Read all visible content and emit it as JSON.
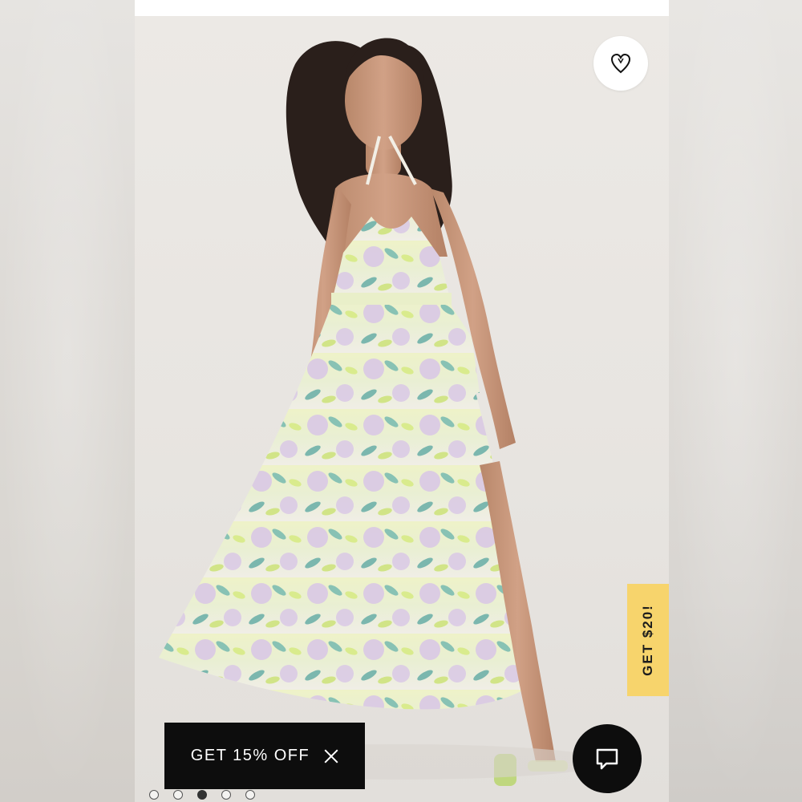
{
  "product": {
    "image_alt": "Model wearing floral halter maxi dress",
    "favorited": false
  },
  "icons": {
    "favorite": "heart-outline-icon",
    "close": "close-icon",
    "chat": "chat-bubble-icon"
  },
  "promo_tab": {
    "label": "GET $20!"
  },
  "discount_banner": {
    "label": "GET 15% OFF"
  },
  "carousel": {
    "total": 5,
    "active_index": 2
  },
  "colors": {
    "promo_yellow": "#f7d46c",
    "banner_black": "#0d0d0d",
    "background": "#e8e5e1"
  }
}
